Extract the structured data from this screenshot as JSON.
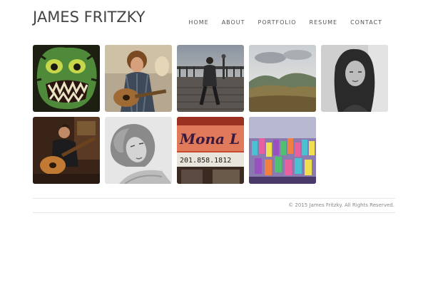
{
  "header": {
    "site_title": "JAMES FRITZKY"
  },
  "nav": {
    "items": [
      {
        "label": "HOME"
      },
      {
        "label": "ABOUT"
      },
      {
        "label": "PORTFOLIO"
      },
      {
        "label": "RESUME"
      },
      {
        "label": "CONTACT"
      }
    ]
  },
  "gallery": {
    "tiles": [
      {
        "subject": "green-monster-illustration"
      },
      {
        "subject": "man-with-acoustic-guitar"
      },
      {
        "subject": "man-on-boardwalk"
      },
      {
        "subject": "landscape-hills"
      },
      {
        "subject": "woman-portrait-bw"
      },
      {
        "subject": "guitarist-indoors"
      },
      {
        "subject": "woman-portrait-bw-lying"
      },
      {
        "subject": "storefront-sign",
        "sign_text": "Mona L",
        "phone_text": "201.858.1812"
      },
      {
        "subject": "stage-performance"
      }
    ]
  },
  "footer": {
    "copyright": "© 2015 James Fritzky. All Rights Reserved."
  }
}
